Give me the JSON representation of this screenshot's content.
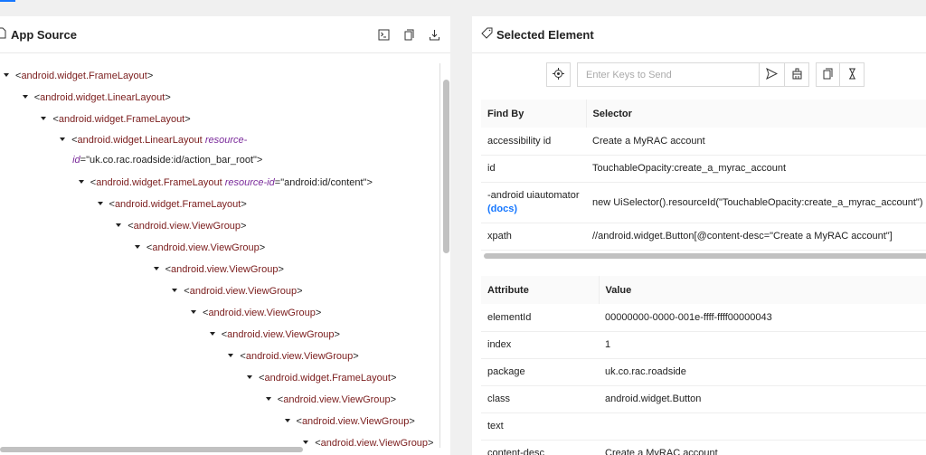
{
  "app_source": {
    "title": "App Source",
    "tree": [
      {
        "level": 0,
        "tag": "android.widget.FrameLayout"
      },
      {
        "level": 1,
        "tag": "android.widget.LinearLayout"
      },
      {
        "level": 2,
        "tag": "android.widget.FrameLayout"
      },
      {
        "level": 3,
        "tag": "android.widget.LinearLayout",
        "attr": "resource-",
        "attr2": "id",
        "value": "\"uk.co.rac.roadside:id/action_bar_root\""
      },
      {
        "level": 4,
        "tag": "android.widget.FrameLayout",
        "attr": "resource-id",
        "value": "\"android:id/content\""
      },
      {
        "level": 5,
        "tag": "android.widget.FrameLayout"
      },
      {
        "level": 6,
        "tag": "android.view.ViewGroup"
      },
      {
        "level": 7,
        "tag": "android.view.ViewGroup"
      },
      {
        "level": 8,
        "tag": "android.view.ViewGroup"
      },
      {
        "level": 9,
        "tag": "android.view.ViewGroup"
      },
      {
        "level": 10,
        "tag": "android.view.ViewGroup"
      },
      {
        "level": 11,
        "tag": "android.view.ViewGroup"
      },
      {
        "level": 12,
        "tag": "android.view.ViewGroup"
      },
      {
        "level": 13,
        "tag": "android.widget.FrameLayout"
      },
      {
        "level": 14,
        "tag": "android.view.ViewGroup"
      },
      {
        "level": 15,
        "tag": "android.view.ViewGroup"
      },
      {
        "level": 16,
        "tag": "android.view.ViewGroup"
      }
    ]
  },
  "selected_element": {
    "title": "Selected Element",
    "send_keys_placeholder": "Enter Keys to Send",
    "selectors": {
      "headers": [
        "Find By",
        "Selector"
      ],
      "rows": [
        {
          "by": "accessibility id",
          "value": "Create a MyRAC account"
        },
        {
          "by": "id",
          "value": "TouchableOpacity:create_a_myrac_account"
        },
        {
          "by": "-android uiautomator",
          "docs": "(docs)",
          "value": "new UiSelector().resourceId(\"TouchableOpacity:create_a_myrac_account\")"
        },
        {
          "by": "xpath",
          "value": "//android.widget.Button[@content-desc=\"Create a MyRAC account\"]"
        }
      ]
    },
    "attributes": {
      "headers": [
        "Attribute",
        "Value"
      ],
      "rows": [
        {
          "name": "elementId",
          "value": "00000000-0000-001e-ffff-ffff00000043"
        },
        {
          "name": "index",
          "value": "1"
        },
        {
          "name": "package",
          "value": "uk.co.rac.roadside"
        },
        {
          "name": "class",
          "value": "android.widget.Button"
        },
        {
          "name": "text",
          "value": ""
        },
        {
          "name": "content-desc",
          "value": "Create a MyRAC account"
        }
      ]
    }
  }
}
